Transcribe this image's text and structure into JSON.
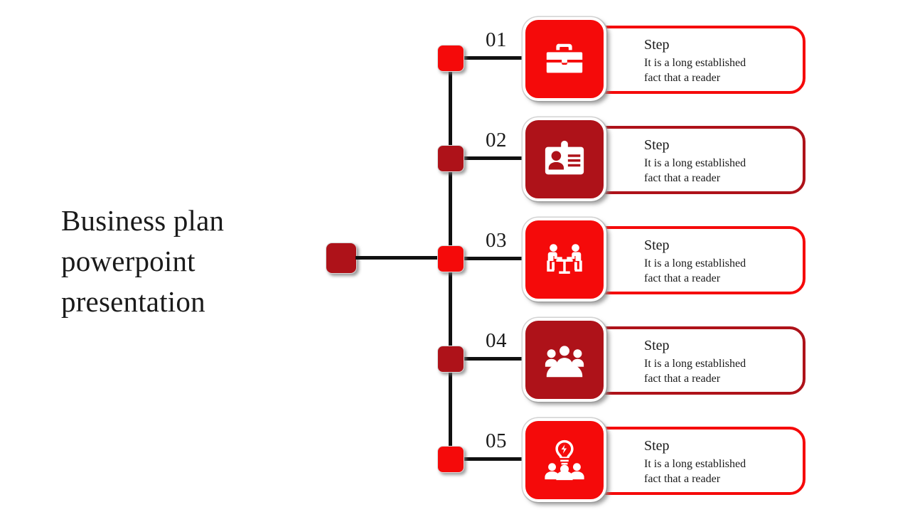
{
  "slide": {
    "title": "Business plan\npowerpoint\npresentation",
    "background": "#FFFFFF"
  },
  "colors": {
    "bright_red": "#F50A0A",
    "dark_red": "#AE1219",
    "line_black": "#111111",
    "text_black": "#1A1A1A",
    "tile_ring": "#FFFFFF"
  },
  "diagram": {
    "left_anchor_color": "#AE1219",
    "steps": [
      {
        "number": "01",
        "icon": "briefcase-icon",
        "color": "#F50A0A",
        "title": "Step",
        "body": "It is a long established\nfact that a reader"
      },
      {
        "number": "02",
        "icon": "id-badge-icon",
        "color": "#AE1219",
        "title": "Step",
        "body": "It is a long established\nfact that a reader"
      },
      {
        "number": "03",
        "icon": "meeting-table-icon",
        "color": "#F50A0A",
        "title": "Step",
        "body": "It is a long established\nfact that a reader"
      },
      {
        "number": "04",
        "icon": "group-people-icon",
        "color": "#AE1219",
        "title": "Step",
        "body": "It is a long established\nfact that a reader"
      },
      {
        "number": "05",
        "icon": "team-idea-bulb-icon",
        "color": "#F50A0A",
        "title": "Step",
        "body": "It is a long established\nfact that a reader"
      }
    ]
  }
}
